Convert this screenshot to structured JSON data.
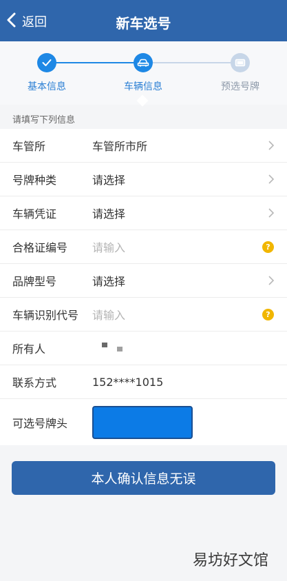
{
  "header": {
    "back_label": "返回",
    "title": "新车选号"
  },
  "steps": [
    {
      "label": "基本信息",
      "state": "done"
    },
    {
      "label": "车辆信息",
      "state": "current"
    },
    {
      "label": "预选号牌",
      "state": "pending"
    }
  ],
  "section_title": "请填写下列信息",
  "fields": [
    {
      "label": "车管所",
      "value": "车管所市所",
      "kind": "select"
    },
    {
      "label": "号牌种类",
      "value": "请选择",
      "kind": "select"
    },
    {
      "label": "车辆凭证",
      "value": "请选择",
      "kind": "select"
    },
    {
      "label": "合格证编号",
      "placeholder": "请输入",
      "kind": "input-help"
    },
    {
      "label": "品牌型号",
      "value": "请选择",
      "kind": "select"
    },
    {
      "label": "车辆识别代号",
      "placeholder": "请输入",
      "kind": "input-help"
    },
    {
      "label": "所有人",
      "kind": "redacted"
    },
    {
      "label": "联系方式",
      "value": "152****1015",
      "kind": "text"
    },
    {
      "label": "可选号牌头",
      "kind": "plate-select"
    }
  ],
  "confirm_label": "本人确认信息无误",
  "watermark": "易坊好文馆",
  "colors": {
    "primary": "#2f66ac",
    "step_active": "#1e88e5",
    "step_inactive": "#c7d6e8",
    "help_badge": "#f1b600",
    "plate_fill": "#0c7be6"
  }
}
